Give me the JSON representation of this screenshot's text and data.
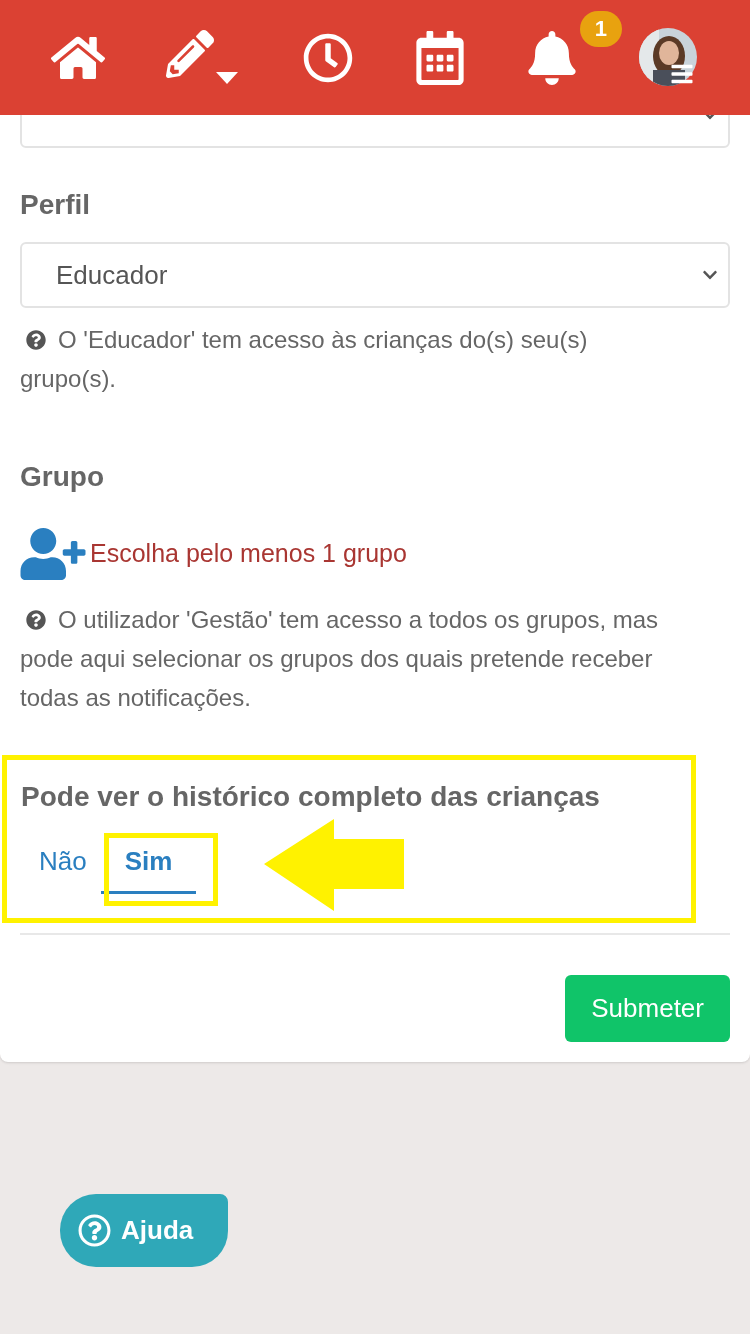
{
  "header": {
    "notification_badge": "1"
  },
  "profile": {
    "label": "Perfil",
    "select_value": "Educador",
    "help": "O 'Educador' tem acesso às crianças do(s) seu(s) grupo(s)."
  },
  "group": {
    "label": "Grupo",
    "add_link": "Escolha pelo menos 1 grupo",
    "help": "O utilizador 'Gestão' tem acesso a todos os grupos, mas pode aqui selecionar os grupos dos quais pretende receber todas as notificações."
  },
  "history": {
    "label": "Pode ver o histórico completo das crianças",
    "tabs": [
      {
        "label": "Não",
        "selected": false
      },
      {
        "label": "Sim",
        "selected": true
      }
    ]
  },
  "submit": "Submeter",
  "help_button": "Ajuda"
}
